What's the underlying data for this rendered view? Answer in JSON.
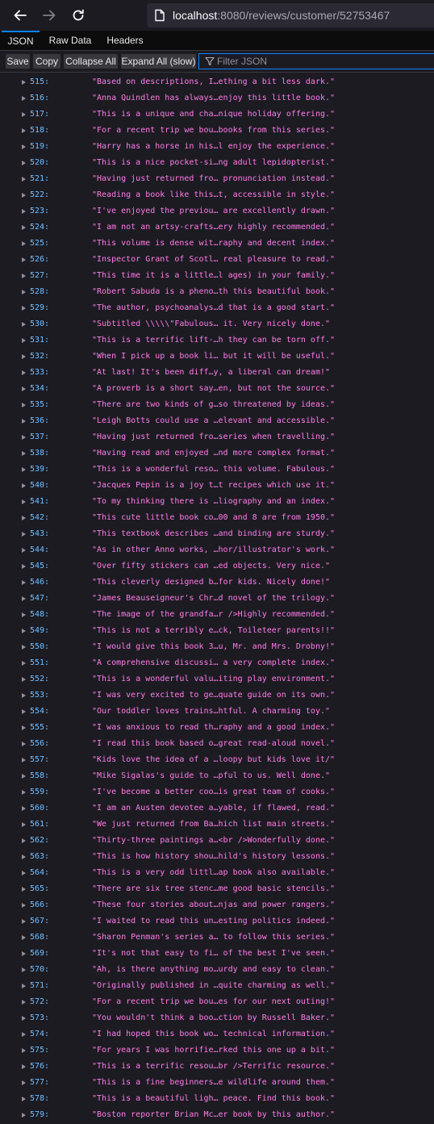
{
  "browser": {
    "url_host": "localhost",
    "url_path": ":8080/reviews/customer/52753467"
  },
  "tabs": [
    {
      "label": "JSON",
      "selected": true
    },
    {
      "label": "Raw Data",
      "selected": false
    },
    {
      "label": "Headers",
      "selected": false
    }
  ],
  "toolbar": {
    "save": "Save",
    "copy": "Copy",
    "collapse_all": "Collapse All",
    "expand_all": "Expand All (slow)",
    "filter_placeholder": "Filter JSON"
  },
  "colors": {
    "key": "#75bfff",
    "string": "#ff7de9",
    "accent": "#0a84ff"
  },
  "rows": [
    {
      "key": "515:",
      "value": "\"Based on descriptions, I…ething a bit less dark.\""
    },
    {
      "key": "516:",
      "value": "\"Anna Quindlen has always…enjoy this little book.\""
    },
    {
      "key": "517:",
      "value": "\"This is a unique and cha…nique holiday offering.\""
    },
    {
      "key": "518:",
      "value": "\"For a recent trip we bou…books from this series.\""
    },
    {
      "key": "519:",
      "value": "\"Harry has a horse in his…l enjoy the experience.\""
    },
    {
      "key": "520:",
      "value": "\"This is a nice pocket-si…ng adult lepidopterist.\""
    },
    {
      "key": "521:",
      "value": "\"Having just returned fro… pronunciation instead.\""
    },
    {
      "key": "522:",
      "value": "\"Reading a book like this…t, accessible in style.\""
    },
    {
      "key": "523:",
      "value": "\"I've enjoyed the previou… are excellently drawn.\""
    },
    {
      "key": "524:",
      "value": "\"I am not an artsy-crafts…ery highly recommended.\""
    },
    {
      "key": "525:",
      "value": "\"This volume is dense wit…raphy and decent index.\""
    },
    {
      "key": "526:",
      "value": "\"Inspector Grant of Scotl… real pleasure to read.\""
    },
    {
      "key": "527:",
      "value": "\"This time it is a little…l ages) in your family.\""
    },
    {
      "key": "528:",
      "value": "\"Robert Sabuda is a pheno…th this beautiful book.\""
    },
    {
      "key": "529:",
      "value": "\"The author, psychoanalys…d that is a good start.\""
    },
    {
      "key": "530:",
      "value": "\"Subtitled \\\\\\\\\\\"Fabulous… it.  Very nicely done.\""
    },
    {
      "key": "531:",
      "value": "\"This is a terrific lift-…h they can be torn off.\""
    },
    {
      "key": "532:",
      "value": "\"When I pick up a book li… but it will be useful.\""
    },
    {
      "key": "533:",
      "value": "\"At last!  It's been diff…y, a liberal can dream!\""
    },
    {
      "key": "534:",
      "value": "\"A proverb is a short say…en, but not the source.\""
    },
    {
      "key": "535:",
      "value": "\"There are two kinds of g…so threatened by ideas.\""
    },
    {
      "key": "536:",
      "value": "\"Leigh Botts could use a …elevant and accessible.\""
    },
    {
      "key": "537:",
      "value": "\"Having just returned fro…series when travelling.\""
    },
    {
      "key": "538:",
      "value": "\"Having read and enjoyed …nd more complex format.\""
    },
    {
      "key": "539:",
      "value": "\"This is a wonderful reso… this volume. Fabulous.\""
    },
    {
      "key": "540:",
      "value": "\"Jacques Pepin is a joy t…t recipes which use it.\""
    },
    {
      "key": "541:",
      "value": "\"To my thinking there is …liography and an index.\""
    },
    {
      "key": "542:",
      "value": "\"This cute little book co…00 and 8 are from 1950.\""
    },
    {
      "key": "543:",
      "value": "\"This textbook describes …and binding are sturdy.\""
    },
    {
      "key": "544:",
      "value": "\"As in other Anno works, …hor/illustrator's work.\""
    },
    {
      "key": "545:",
      "value": "\"Over fifty stickers can …ed objects.  Very nice.\""
    },
    {
      "key": "546:",
      "value": "\"This cleverly designed b…for kids.  Nicely done!\""
    },
    {
      "key": "547:",
      "value": "\"James Beauseigneur's Chr…d novel of the trilogy.\""
    },
    {
      "key": "548:",
      "value": "\"The image of the grandfa…r />Highly recommended.\""
    },
    {
      "key": "549:",
      "value": "\"This is not a terribly e…ck, Toileteer parents!!\""
    },
    {
      "key": "550:",
      "value": "\"I would give this book 3…u, Mr. and Mrs. Drobny!\""
    },
    {
      "key": "551:",
      "value": "\"A comprehensive discussi… a very complete index.\""
    },
    {
      "key": "552:",
      "value": "\"This is a wonderful valu…iting play environment.\""
    },
    {
      "key": "553:",
      "value": "\"I was very excited to ge…quate guide on its own.\""
    },
    {
      "key": "554:",
      "value": "\"Our toddler loves trains…htful.  A charming toy.\""
    },
    {
      "key": "555:",
      "value": "\"I was anxious to read th…raphy and a good index.\""
    },
    {
      "key": "556:",
      "value": "\"I read this book based o…great read-aloud novel.\""
    },
    {
      "key": "557:",
      "value": "\"Kids love the idea of a …loopy but kids love it/\""
    },
    {
      "key": "558:",
      "value": "\"Mike Sigalas's guide to …pful to us.  Well done.\""
    },
    {
      "key": "559:",
      "value": "\"I've become a better coo…is great team of cooks.\""
    },
    {
      "key": "560:",
      "value": "\"I am an Austen devotee a…yable, if flawed, read.\""
    },
    {
      "key": "561:",
      "value": "\"We just returned from Ba…hich list main streets.\""
    },
    {
      "key": "562:",
      "value": "\"Thirty-three paintings a…<br />Wonderfully done.\""
    },
    {
      "key": "563:",
      "value": "\"This is how history shou…hild's history lessons.\""
    },
    {
      "key": "564:",
      "value": "\"This is a very odd littl…ap book also available.\""
    },
    {
      "key": "565:",
      "value": "\"There are six tree stenc…me good basic stencils.\""
    },
    {
      "key": "566:",
      "value": "\"These four stories about…njas and power rangers.\""
    },
    {
      "key": "567:",
      "value": "\"I waited to read this un…esting politics indeed.\""
    },
    {
      "key": "568:",
      "value": "\"Sharon Penman's series a… to follow this series.\""
    },
    {
      "key": "569:",
      "value": "\"It's not that easy to fi… of the best I've seen.\""
    },
    {
      "key": "570:",
      "value": "\"Ah, is there anything mo…urdy and easy to clean.\""
    },
    {
      "key": "571:",
      "value": "\"Originally published in …quite charming as well.\""
    },
    {
      "key": "572:",
      "value": "\"For a recent trip we bou…es for our next outing!\""
    },
    {
      "key": "573:",
      "value": "\"You wouldn't think a boo…ction by Russell Baker.\""
    },
    {
      "key": "574:",
      "value": "\"I had hoped this book wo… technical information.\""
    },
    {
      "key": "575:",
      "value": "\"For years I was horrifie…rked this one up a bit.\""
    },
    {
      "key": "576:",
      "value": "\"This is a terrific resou…br />Terrific resource.\""
    },
    {
      "key": "577:",
      "value": "\"This is a fine beginners…e wildlife around them.\""
    },
    {
      "key": "578:",
      "value": "\"This is a beautiful ligh… peace. Find this book.\""
    },
    {
      "key": "579:",
      "value": "\"Boston reporter Brian Mc…er book by this author.\""
    }
  ]
}
